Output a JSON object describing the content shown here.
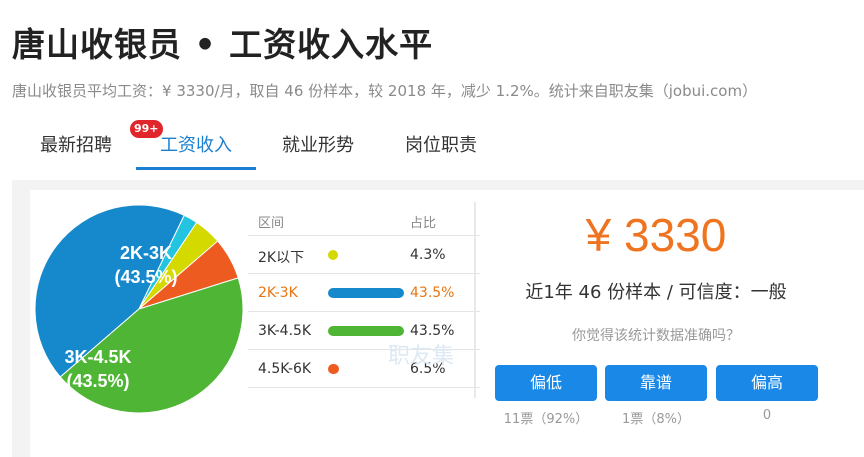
{
  "title": "唐山收银员 • 工资收入水平",
  "subtitle": "唐山收银员平均工资：¥ 3330/月，取自 46 份样本，较 2018 年，减少 1.2%。统计来自职友集（jobui.com）",
  "tabs": [
    {
      "label": "最新招聘",
      "badge": "99+"
    },
    {
      "label": "工资收入",
      "active": true
    },
    {
      "label": "就业形势"
    },
    {
      "label": "岗位职责"
    }
  ],
  "distribution": {
    "header_range": "区间",
    "header_pct": "占比",
    "rows": [
      {
        "range": "2K以下",
        "pct": "4.3%",
        "value": 4.3,
        "color": "#d4d900"
      },
      {
        "range": "2K-3K",
        "pct": "43.5%",
        "value": 43.5,
        "color": "#1689cc"
      },
      {
        "range": "3K-4.5K",
        "pct": "43.5%",
        "value": 43.5,
        "color": "#4fb534"
      },
      {
        "range": "4.5K-6K",
        "pct": "6.5%",
        "value": 6.5,
        "color": "#ee5b21"
      }
    ]
  },
  "pie": {
    "label_a_range": "2K-3K",
    "label_a_pct": "(43.5%)",
    "label_b_range": "3K-4.5K",
    "label_b_pct": "(43.5%)",
    "extra_slice_color": "#23c4e0"
  },
  "watermark": "职友集",
  "salary": {
    "amount": "¥ 3330",
    "sample_text": "近1年 46 份样本 / 可信度：一般",
    "question": "你觉得该统计数据准确吗？"
  },
  "votes": [
    {
      "label": "偏低",
      "count": "11票（92%）"
    },
    {
      "label": "靠谱",
      "count": "1票（8%）"
    },
    {
      "label": "偏高",
      "count": "0"
    }
  ],
  "colors": {
    "accent": "#1a7fd0",
    "orange": "#ef7420",
    "badge": "#e0262b",
    "button": "#1a88e6"
  }
}
